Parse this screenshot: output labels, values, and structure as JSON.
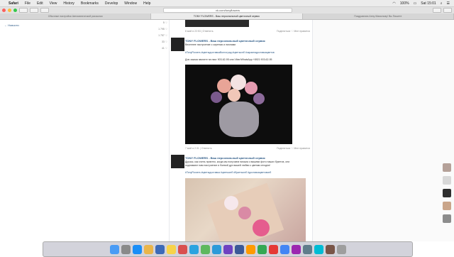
{
  "menubar": {
    "app": "Safari",
    "items": [
      "File",
      "Edit",
      "View",
      "History",
      "Bookmarks",
      "Develop",
      "Window",
      "Help"
    ],
    "battery": "100%",
    "clock": "Sat 15:01"
  },
  "toolbar": {
    "url": "vk.com/tonyflowers"
  },
  "tabs": [
    {
      "label": "Обычные настройки Автоматической рассылки"
    },
    {
      "label": "TONY FLOWERS - Ваш персональный цветочный сервис"
    },
    {
      "label": "Поздравляю Анну Мамонову! Вы Пишете"
    }
  ],
  "sidebar": {
    "back_label": "Новости",
    "counters": [
      "5",
      "1 795",
      "1 757",
      "33",
      "41"
    ]
  },
  "feed": {
    "top_meta": {
      "date": "8 май в 22:53",
      "reply": "Ответить",
      "share": "Поделиться",
      "likes": "Мне нравится"
    },
    "post1": {
      "author": "TONY FLOWERS - Ваш персональный цветочный сервис",
      "line1": "Весеннее настроение с сиренью и пионами",
      "hashtags": "#TonyFlowers #цветыдоставкаВолгоград #цветыспб #окраинадоставкацветов",
      "contact": "Для заказа звоните на нам: 903-62-95 или Viber/WhatsApp +8921 903-62-95",
      "date": "7 май в 2:31",
      "reply": "Ответить",
      "share": "Поделиться",
      "likes": "Мне нравится"
    },
    "post2": {
      "author": "TONY FLOWERS - Ваш персональный цветочный сервис",
      "line1": "Друзья, как очень приятно, когда мы получаем письма с вашими фото наших букетов, они",
      "line2": "поднимают нам настроение и боевой дух вашей любви к цветам сегодня!",
      "hashtags": "#TonyFlowers #цветыдоставка #цветыспб #букетыспб #доставкацветовспб"
    }
  }
}
